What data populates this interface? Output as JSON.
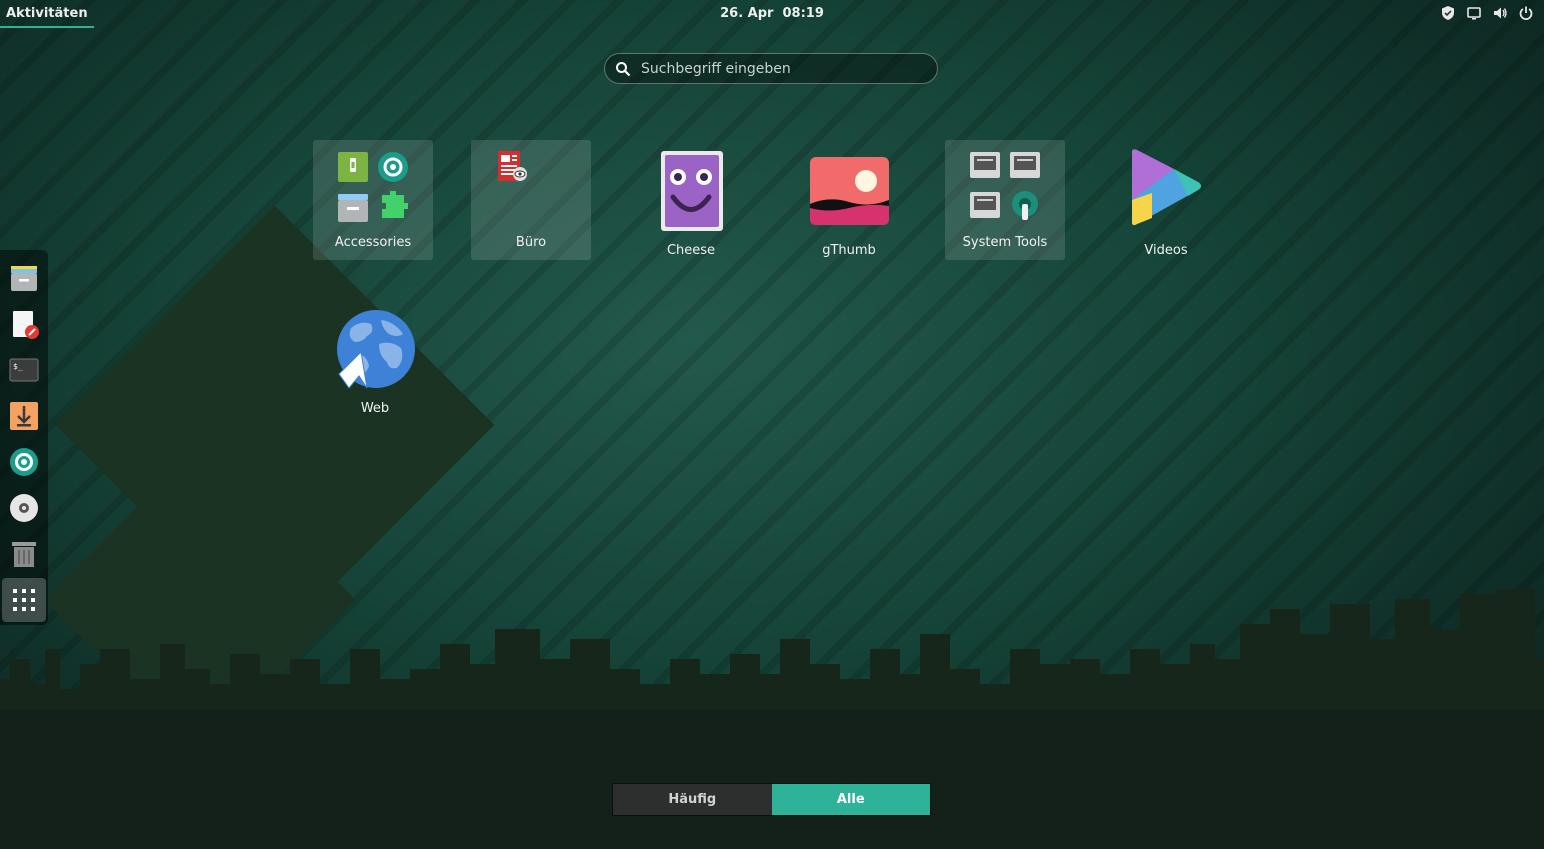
{
  "topbar": {
    "activities_label": "Aktivitäten",
    "clock_text": "26. Apr  08:19",
    "status_icons": [
      "shield-icon",
      "screen-icon",
      "volume-icon",
      "power-icon"
    ]
  },
  "search": {
    "placeholder": "Suchbegriff eingeben"
  },
  "apps": {
    "accessories": "Accessories",
    "buero": "Büro",
    "cheese": "Cheese",
    "gthumb": "gThumb",
    "system_tools": "System Tools",
    "videos": "Videos",
    "web": "Web"
  },
  "dash": {
    "items": [
      "files-icon",
      "text-editor-icon",
      "terminal-icon",
      "downloader-icon",
      "screenshot-icon",
      "disc-icon",
      "trash-icon",
      "show-apps-icon"
    ]
  },
  "view_switch": {
    "frequent_label": "Häufig",
    "all_label": "Alle",
    "active": "all"
  },
  "colors": {
    "accent": "#2eb398",
    "background": "#154337"
  }
}
